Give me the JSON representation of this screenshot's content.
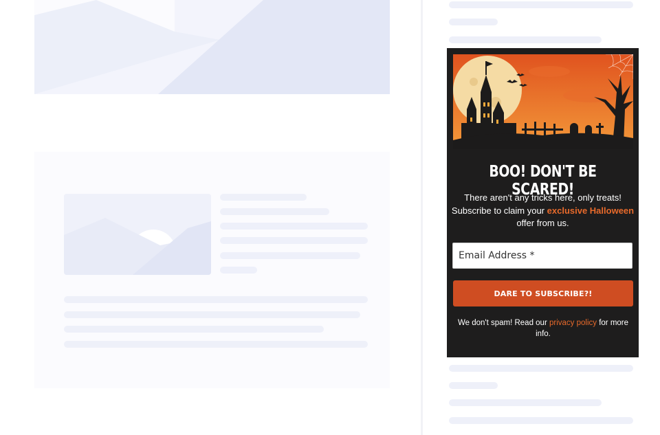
{
  "popup": {
    "headline": "BOO! DON'T BE SCARED!",
    "body_prefix": "There aren't any tricks here, only treats! Subscribe to claim your ",
    "body_highlight": "exclusive Halloween",
    "body_suffix": " offer from us.",
    "email_placeholder": "Email Address *",
    "cta_label": "DARE TO SUBSCRIBE?!",
    "fine_prefix": "We don't spam! Read our ",
    "fine_link": "privacy policy",
    "fine_suffix": " for more info.",
    "colors": {
      "background": "#1e1d1d",
      "accent": "#e86a2b",
      "button": "#cf4d22"
    }
  }
}
